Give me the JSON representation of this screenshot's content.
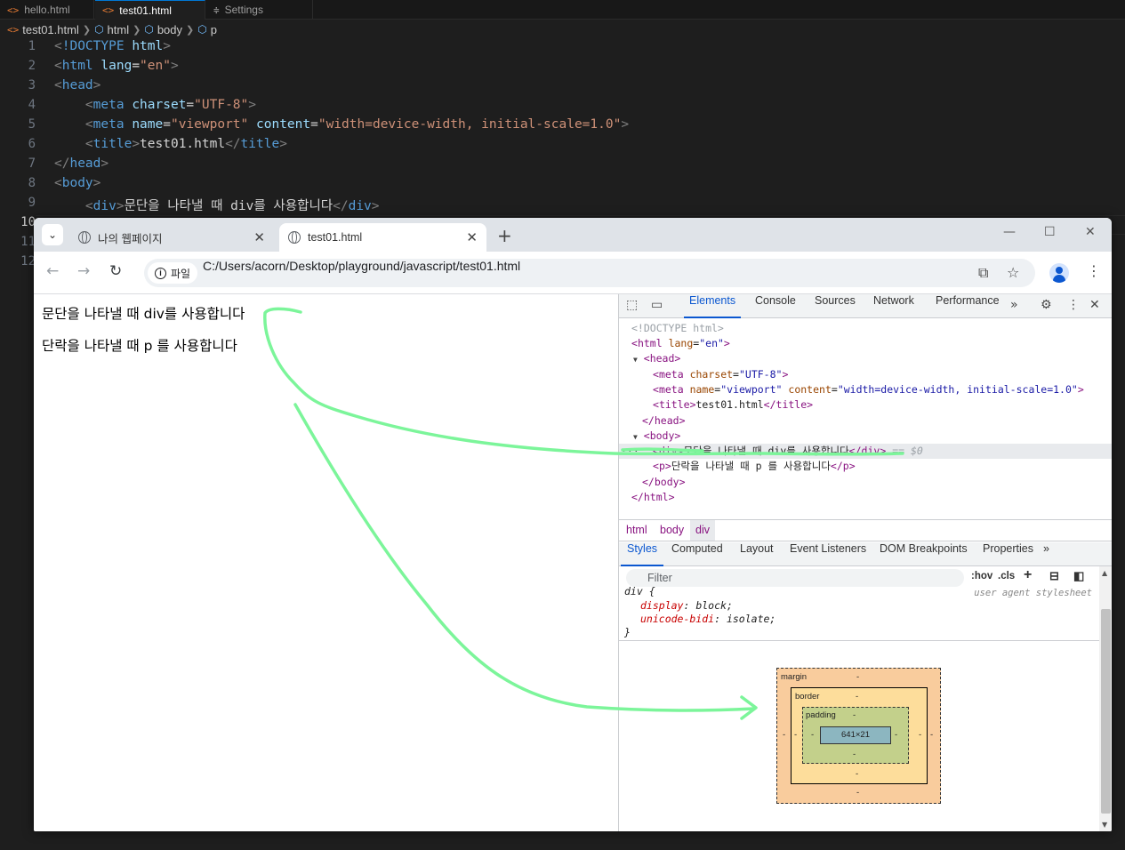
{
  "vscode": {
    "tabs": [
      {
        "label": "hello.html",
        "icon": "html-icon"
      },
      {
        "label": "test01.html",
        "icon": "html-icon"
      },
      {
        "label": "Settings",
        "icon": "settings-icon"
      }
    ],
    "breadcrumb": [
      "test01.html",
      "html",
      "body",
      "p"
    ],
    "line_numbers": [
      "1",
      "2",
      "3",
      "4",
      "5",
      "6",
      "7",
      "8",
      "9",
      "10",
      "11",
      "12"
    ],
    "code": {
      "l1_doctype": "!DOCTYPE",
      "l1_html": "html",
      "tag_html": "html",
      "attr_lang": "lang",
      "val_en": "\"en\"",
      "tag_head": "head",
      "tag_meta": "meta",
      "attr_charset": "charset",
      "val_utf8": "\"UTF-8\"",
      "attr_name": "name",
      "val_viewport": "\"viewport\"",
      "attr_content": "content",
      "val_content": "\"width=device-width, initial-scale=1.0\"",
      "tag_title": "title",
      "title_text": "test01.html",
      "tag_body": "body",
      "tag_div": "div",
      "div_text": "문단을 나타낼 때 div를 사용합니다"
    }
  },
  "browser": {
    "tabs": [
      {
        "label": "나의 웹페이지"
      },
      {
        "label": "test01.html"
      }
    ],
    "omnibox": {
      "chip_label": "파일",
      "url": "C:/Users/acorn/Desktop/playground/javascript/test01.html"
    },
    "page": {
      "div_text": "문단을 나타낼 때 div를 사용합니다",
      "p_text": "단락을 나타낼 때 p 를 사용합니다"
    }
  },
  "devtools": {
    "tabs": [
      "Elements",
      "Console",
      "Sources",
      "Network",
      "Performance"
    ],
    "active_tab": "Elements",
    "dom": {
      "doctype": "<!DOCTYPE html>",
      "html_open": "html",
      "lang_attr": "lang",
      "lang_val": "\"en\"",
      "head": "head",
      "meta": "meta",
      "charset_attr": "charset",
      "charset_val": "\"UTF-8\"",
      "name_attr": "name",
      "name_val": "\"viewport\"",
      "content_attr": "content",
      "content_val": "\"width=device-width, initial-scale=1.0\"",
      "title": "title",
      "title_text": "test01.html",
      "body": "body",
      "div": "div",
      "div_text": "문단을 나타낼 때 div를 사용합니다",
      "selected_suffix": "== $0",
      "p": "p",
      "p_text": "단락을 나타낼 때 p 를 사용합니다"
    },
    "breadcrumbs": [
      "html",
      "body",
      "div"
    ],
    "subtabs": [
      "Styles",
      "Computed",
      "Layout",
      "Event Listeners",
      "DOM Breakpoints",
      "Properties"
    ],
    "active_subtab": "Styles",
    "filter_placeholder": "Filter",
    "hov_label": ":hov",
    "cls_label": ".cls",
    "style_rule": {
      "selector": "div {",
      "source": "user agent stylesheet",
      "props": [
        {
          "name": "display",
          "value": "block"
        },
        {
          "name": "unicode-bidi",
          "value": "isolate"
        }
      ],
      "close": "}"
    },
    "box_model": {
      "margin_label": "margin",
      "border_label": "border",
      "padding_label": "padding",
      "content_size": "641×21",
      "dash": "-"
    }
  },
  "annotation_color": "#7cf59a"
}
